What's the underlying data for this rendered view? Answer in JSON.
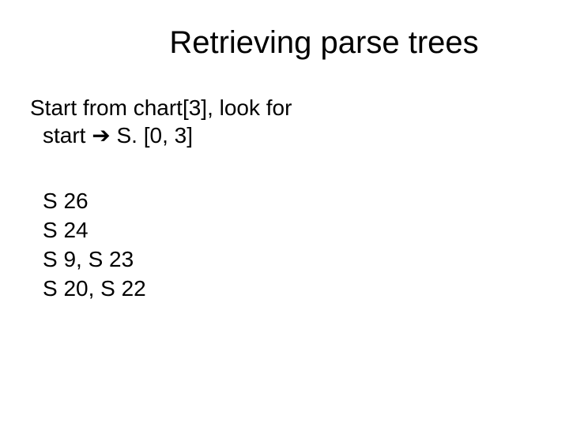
{
  "title": "Retrieving parse trees",
  "line1": "Start from chart[3], look for",
  "line2_prefix": "start ",
  "line2_arrow": "➔",
  "line2_suffix": " S.  [0, 3]",
  "items": [
    "S 26",
    "S 24",
    "S 9, S 23",
    "S 20, S 22"
  ]
}
